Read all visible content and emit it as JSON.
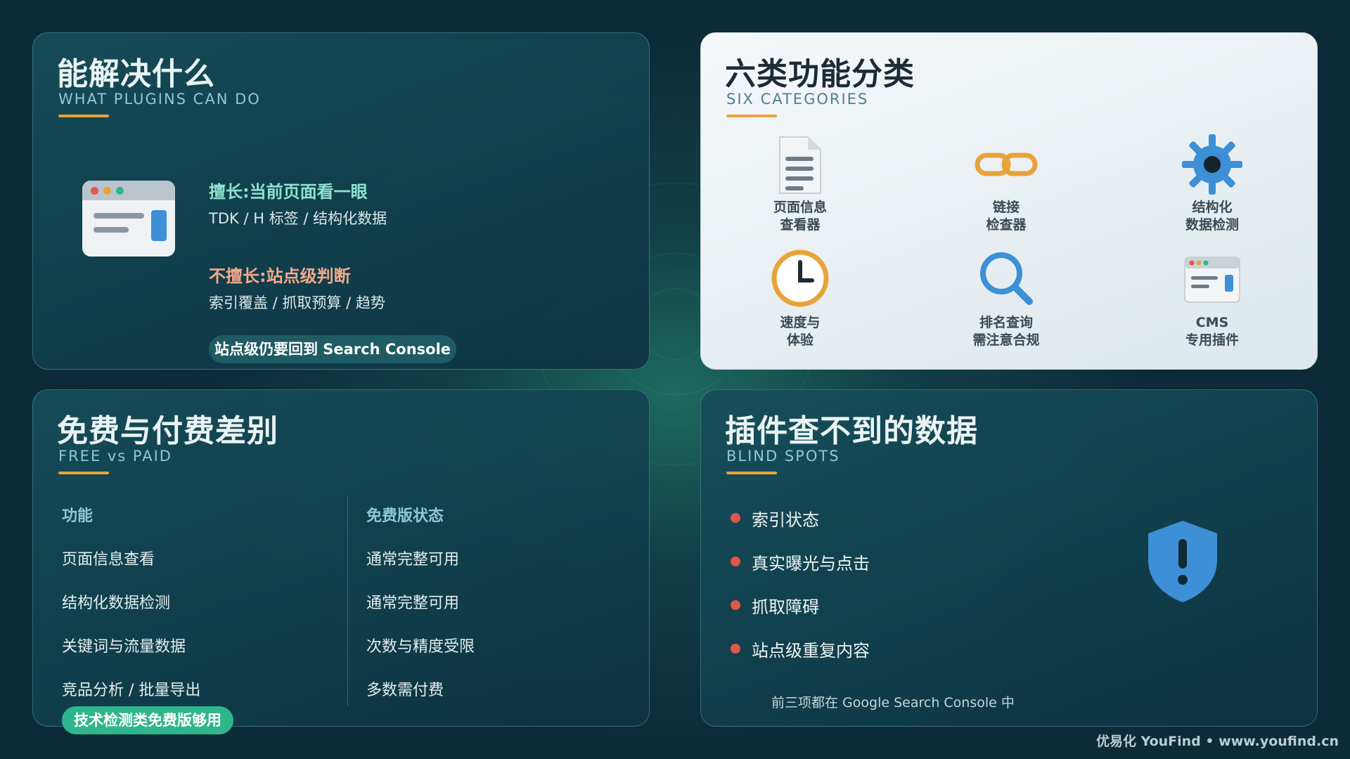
{
  "panel_what": {
    "title": "能解决什么",
    "subtitle": "WHAT PLUGINS CAN DO",
    "good_heading": "擅长:当前页面看一眼",
    "good_detail": "TDK / H 标签 / 结构化数据",
    "bad_heading": "不擅长:站点级判断",
    "bad_detail": "索引覆盖 / 抓取预算 / 趋势",
    "pill": "站点级仍要回到 Search Console",
    "icon": "browser-window-icon"
  },
  "panel_categories": {
    "title": "六类功能分类",
    "subtitle": "SIX CATEGORIES",
    "items": [
      {
        "line1": "页面信息",
        "line2": "查看器",
        "icon": "document-icon"
      },
      {
        "line1": "链接",
        "line2": "检查器",
        "icon": "link-icon"
      },
      {
        "line1": "结构化",
        "line2": "数据检测",
        "icon": "gear-icon"
      },
      {
        "line1": "速度与",
        "line2": "体验",
        "icon": "clock-icon"
      },
      {
        "line1": "排名查询",
        "line2": "需注意合规",
        "icon": "search-icon"
      },
      {
        "line1": "CMS",
        "line2": "专用插件",
        "icon": "browser-window-icon"
      }
    ],
    "colors": {
      "blue": "#3d8fd6",
      "orange": "#e7a33a",
      "gray": "#6f7b85"
    }
  },
  "panel_free_paid": {
    "title": "免费与付费差别",
    "subtitle": "FREE vs PAID",
    "headers": [
      "功能",
      "免费版状态"
    ],
    "rows": [
      [
        "页面信息查看",
        "通常完整可用"
      ],
      [
        "结构化数据检测",
        "通常完整可用"
      ],
      [
        "关键词与流量数据",
        "次数与精度受限"
      ],
      [
        "竞品分析 / 批量导出",
        "多数需付费"
      ]
    ],
    "badge": "技术检测类免费版够用"
  },
  "panel_blind": {
    "title": "插件查不到的数据",
    "subtitle": "BLIND SPOTS",
    "items": [
      "索引状态",
      "真实曝光与点击",
      "抓取障碍",
      "站点级重复内容"
    ],
    "note": "前三项都在 Google Search Console 中",
    "icon": "shield-alert-icon"
  },
  "footer": "优易化 YouFind • www.youfind.cn",
  "accent_colors": {
    "underline": "#e7a33a",
    "bullet": "#e0574b",
    "pill_green": "#2fb58c",
    "shield": "#3d8fd6"
  }
}
